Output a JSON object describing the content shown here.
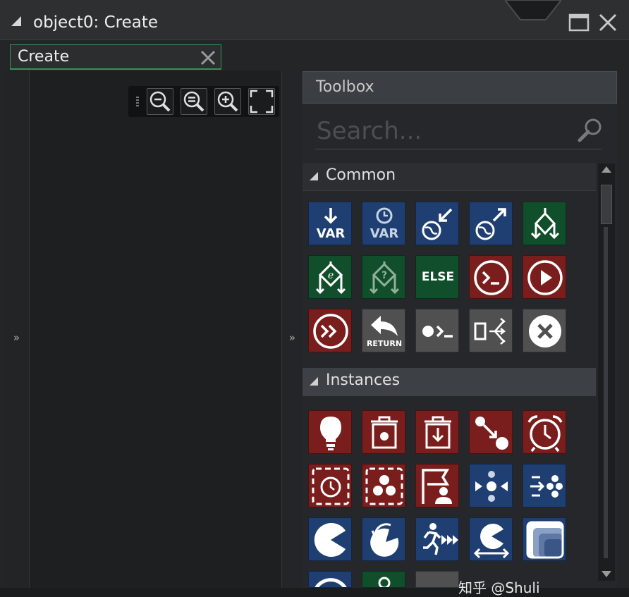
{
  "window": {
    "title": "object0: Create"
  },
  "tab": {
    "label": "Create"
  },
  "expand_glyph": "»",
  "toolbox": {
    "title": "Toolbox",
    "search_placeholder": "Search...",
    "sections": {
      "common": {
        "label": "Common",
        "items": [
          {
            "name": "assign-variable-icon",
            "color": "blue",
            "text": "VAR"
          },
          {
            "name": "temp-variable-icon",
            "color": "blue",
            "text": "VAR"
          },
          {
            "name": "get-global-variable-icon",
            "color": "blue"
          },
          {
            "name": "set-global-variable-icon",
            "color": "blue"
          },
          {
            "name": "if-variable-icon",
            "color": "green"
          },
          {
            "name": "if-expression-icon",
            "color": "green"
          },
          {
            "name": "if-undefined-icon",
            "color": "green"
          },
          {
            "name": "else-icon",
            "color": "green",
            "text": "ELSE"
          },
          {
            "name": "execute-code-icon",
            "color": "red"
          },
          {
            "name": "function-call-icon",
            "color": "red"
          },
          {
            "name": "execute-script-icon",
            "color": "red"
          },
          {
            "name": "return-icon",
            "color": "gray",
            "text": "RETURN"
          },
          {
            "name": "declare-function-icon",
            "color": "gray"
          },
          {
            "name": "switch-icon",
            "color": "gray"
          },
          {
            "name": "exit-event-icon",
            "color": "gray"
          }
        ]
      },
      "instances": {
        "label": "Instances",
        "items": [
          {
            "name": "create-instance-icon",
            "color": "red"
          },
          {
            "name": "destroy-instance-icon",
            "color": "red"
          },
          {
            "name": "destroy-at-position-icon",
            "color": "red"
          },
          {
            "name": "change-instance-icon",
            "color": "red"
          },
          {
            "name": "set-alarm-icon",
            "color": "red"
          },
          {
            "name": "get-alarm-icon",
            "color": "red"
          },
          {
            "name": "instance-count-icon",
            "color": "red"
          },
          {
            "name": "instance-exists-icon",
            "color": "red"
          },
          {
            "name": "jump-to-point-icon",
            "color": "blue"
          },
          {
            "name": "jump-to-start-icon",
            "color": "blue"
          },
          {
            "name": "set-sprite-icon",
            "color": "blue"
          },
          {
            "name": "rotate-icon",
            "color": "blue"
          },
          {
            "name": "speed-icon",
            "color": "blue"
          },
          {
            "name": "wrap-icon",
            "color": "blue"
          },
          {
            "name": "set-depth-icon",
            "color": "blue"
          }
        ]
      }
    }
  },
  "colors": {
    "blue": "#1f3f72",
    "green": "#114e2b",
    "red": "#7a1d1d",
    "gray": "#505050",
    "tab_accent": "#3c8f5b"
  },
  "watermark": "知乎 @Shuli"
}
